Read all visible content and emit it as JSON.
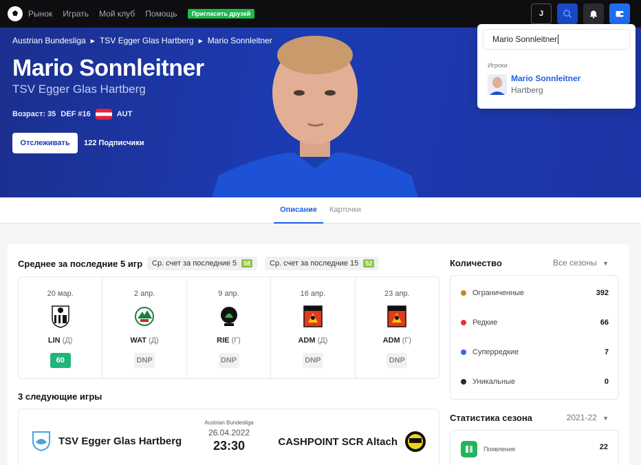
{
  "nav": {
    "links": [
      "Рынок",
      "Играть",
      "Мой клуб",
      "Помощь"
    ],
    "invite": "Пригласить друзей",
    "avatar_letter": "J"
  },
  "hero": {
    "breadcrumb": [
      "Austrian Bundesliga",
      "TSV Egger Glas Hartberg",
      "Mario Sonnleitner"
    ],
    "name": "Mario Sonnleitner",
    "team": "TSV Egger Glas Hartberg",
    "age": "Возраст: 35",
    "position": "DEF #16",
    "nationality": "AUT",
    "follow_label": "Отслеживать",
    "followers": "122 Подписчики"
  },
  "tabs": [
    "Описание",
    "Карточки"
  ],
  "average": {
    "title": "Среднее за последние 5 игр",
    "pill5_label": "Ср. счет за последние 5",
    "pill5_score": "58",
    "pill15_label": "Ср. счет за последние 15",
    "pill15_score": "52"
  },
  "games": [
    {
      "date": "20 мар.",
      "team": "LIN",
      "venue": "(Д)",
      "result": "60",
      "played": true
    },
    {
      "date": "2 апр.",
      "team": "WAT",
      "venue": "(Д)",
      "result": "DNP",
      "played": false
    },
    {
      "date": "9 апр.",
      "team": "RIE",
      "venue": "(Г)",
      "result": "DNP",
      "played": false
    },
    {
      "date": "16 апр.",
      "team": "ADM",
      "venue": "(Д)",
      "result": "DNP",
      "played": false
    },
    {
      "date": "23 апр.",
      "team": "ADM",
      "venue": "(Г)",
      "result": "DNP",
      "played": false
    }
  ],
  "next_games": {
    "title": "3 следующие игры",
    "league": "Austrian Bundesliga",
    "date": "26.04.2022",
    "time": "23:30",
    "home": "TSV Egger Glas Hartberg",
    "away": "CASHPOINT SCR Altach"
  },
  "quantity": {
    "title": "Количество",
    "filter": "Все сезоны",
    "rows": [
      {
        "label": "Ограниченные",
        "value": "392",
        "color": "#c88a1e"
      },
      {
        "label": "Редкие",
        "value": "66",
        "color": "#e0313d"
      },
      {
        "label": "Суперредкие",
        "value": "7",
        "color": "#3a66e8"
      },
      {
        "label": "Уникальные",
        "value": "0",
        "color": "#2b2b2b"
      }
    ]
  },
  "season": {
    "title": "Статистика сезона",
    "filter": "2021-22",
    "appearances_label": "Появления",
    "appearances": "22"
  },
  "search": {
    "query": "Mario Sonnleitner",
    "section": "Игроки",
    "result_name": "Mario Sonnleitner",
    "result_club": "Hartberg"
  },
  "colors": {
    "hero": "#1c3bb2",
    "accent": "#1f5fe0",
    "played": "#22b57b",
    "score": "#8cc43f"
  }
}
